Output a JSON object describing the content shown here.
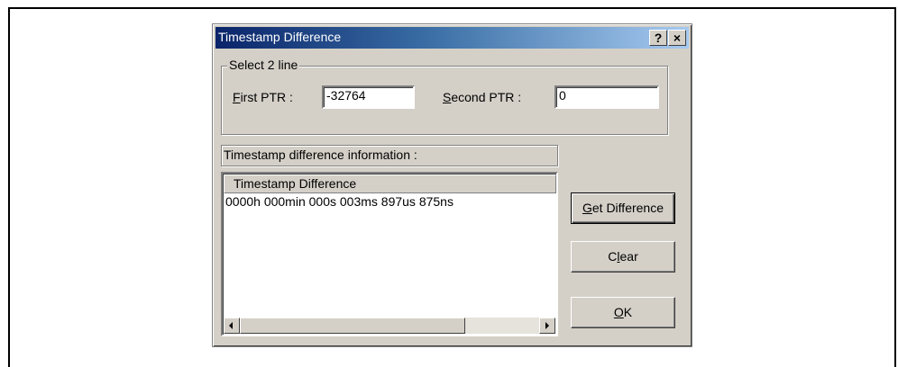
{
  "dialog": {
    "title": "Timestamp Difference",
    "help_button": "?",
    "close_button": "×"
  },
  "select_group": {
    "label": "Select 2 line",
    "first_ptr": {
      "mnemonic": "F",
      "label_rest": "irst PTR :",
      "value": "-32764"
    },
    "second_ptr": {
      "mnemonic": "S",
      "label_rest": "econd PTR :",
      "value": "0"
    }
  },
  "info": {
    "label": "Timestamp difference information :",
    "column_header": "Timestamp Difference",
    "rows": [
      "0000h 000min 000s 003ms 897us 875ns"
    ]
  },
  "buttons": {
    "get_difference": {
      "mnemonic": "G",
      "label_rest": "et Difference"
    },
    "clear": {
      "before": "C",
      "mnemonic": "l",
      "after": "ear"
    },
    "ok": {
      "mnemonic": "O",
      "label_rest": "K"
    }
  }
}
